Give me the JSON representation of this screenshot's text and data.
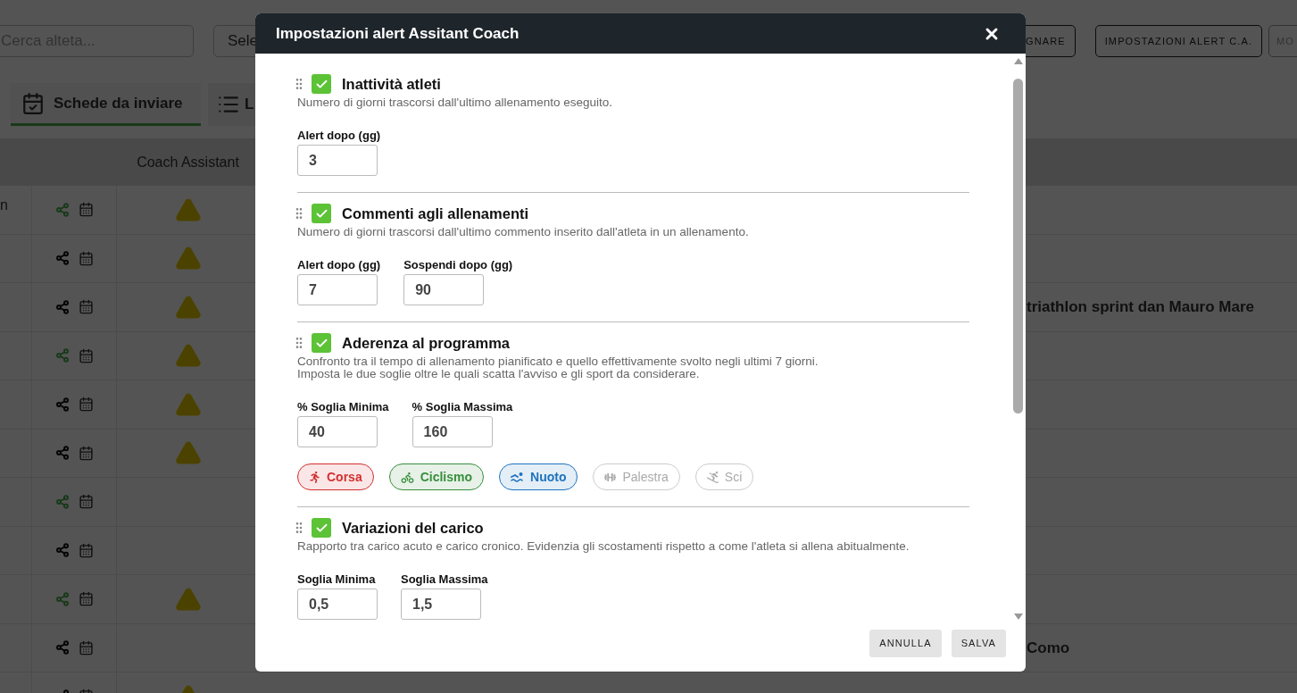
{
  "page": {
    "search": {
      "placeholder": "Cerca alteta..."
    },
    "select_button": "Sele",
    "buttons": [
      {
        "label": "GNARE",
        "kind": "outline"
      },
      {
        "label": "IMPOSTAZIONI ALERT C.A.",
        "kind": "outline"
      },
      {
        "label": "MO",
        "kind": "faded"
      }
    ],
    "tabs": [
      {
        "label": "Schede da inviare",
        "selected": true
      },
      {
        "label": "L",
        "selected": false
      }
    ],
    "table": {
      "columns": [
        {
          "label": "Coach Assistant"
        }
      ],
      "rows": [
        {
          "column_1": "n",
          "shared": true,
          "alert": true
        },
        {
          "shared": false,
          "alert": true
        },
        {
          "shared": false,
          "alert": true,
          "column_last": "triathlon sprint dan Mauro Mare"
        },
        {
          "shared": true,
          "alert": true
        },
        {
          "shared": false,
          "alert": true
        },
        {
          "shared": false,
          "alert": true
        },
        {
          "shared": true,
          "alert": false
        },
        {
          "shared": false,
          "alert": false
        },
        {
          "shared": true,
          "alert": true
        },
        {
          "shared": false,
          "alert": false,
          "column_last": "Como"
        },
        {
          "shared": false,
          "alert": true
        }
      ]
    }
  },
  "dialog": {
    "title": "Impostazioni alert Assitant Coach",
    "sections": [
      {
        "title": "Inattività atleti",
        "checked": true,
        "description": [
          "Numero di giorni trascorsi dall'ultimo allenamento eseguito."
        ],
        "fields": [
          {
            "label": "Alert dopo (gg)",
            "value": "3"
          }
        ]
      },
      {
        "title": "Commenti agli allenamenti",
        "checked": true,
        "description": [
          "Numero di giorni trascorsi dall'ultimo commento inserito dall'atleta in un allenamento."
        ],
        "fields": [
          {
            "label": "Alert dopo (gg)",
            "value": "7"
          },
          {
            "label": "Sospendi dopo (gg)",
            "value": "90"
          }
        ]
      },
      {
        "title": "Aderenza al programma",
        "checked": true,
        "description": [
          "Confronto tra il tempo di allenamento pianificato e quello effettivamente svolto negli ultimi 7 giorni.",
          "Imposta le due soglie oltre le quali scatta l'avviso e gli sport da considerare."
        ],
        "fields": [
          {
            "label": "% Soglia Minima",
            "value": "40"
          },
          {
            "label": "% Soglia Massima",
            "value": "160"
          }
        ],
        "sports": [
          {
            "label": "Corsa",
            "selected": true,
            "color": "#d32f2f"
          },
          {
            "label": "Ciclismo",
            "selected": true,
            "color": "#388e3c"
          },
          {
            "label": "Nuoto",
            "selected": true,
            "color": "#1e73be"
          },
          {
            "label": "Palestra",
            "selected": false
          },
          {
            "label": "Sci",
            "selected": false
          }
        ]
      },
      {
        "title": "Variazioni del carico",
        "checked": true,
        "description": [
          "Rapporto tra carico acuto e carico cronico. Evidenzia gli scostamenti rispetto a come l'atleta si allena abitualmente."
        ],
        "fields": [
          {
            "label": "Soglia Minima",
            "value": "0,5"
          },
          {
            "label": "Soglia Massima",
            "value": "1,5"
          }
        ]
      }
    ],
    "buttons": [
      "ANNULLA",
      "SALVA"
    ]
  }
}
